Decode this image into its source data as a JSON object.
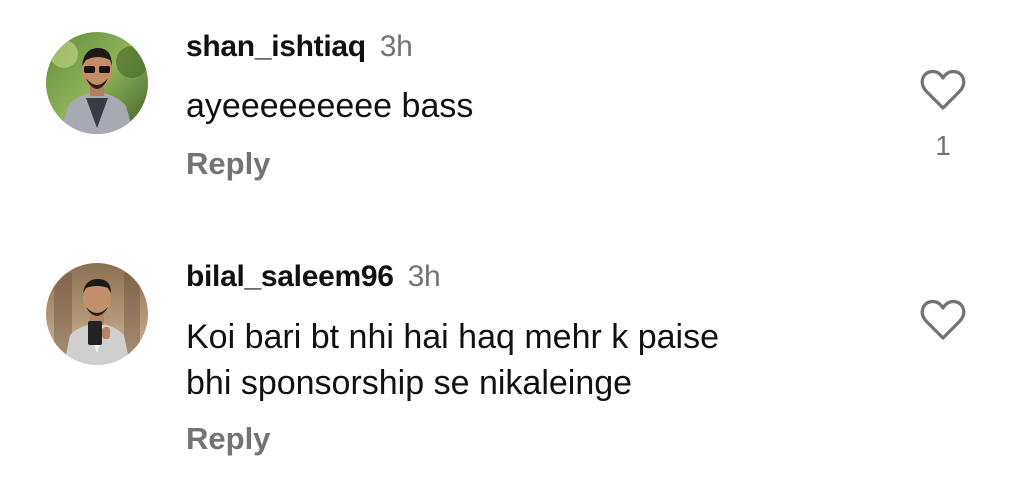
{
  "comments": [
    {
      "username": "shan_ishtiaq",
      "time": "3h",
      "text": "ayeeeeeeeee  bass",
      "reply_label": "Reply",
      "like_count": "1",
      "avatar_icon": "user-photo-avatar-1",
      "heart_icon": "heart-outline-icon"
    },
    {
      "username": "bilal_saleem96",
      "time": "3h",
      "text": "Koi bari bt nhi hai haq mehr k paise\nbhi sponsorship se nikaleinge",
      "reply_label": "Reply",
      "avatar_icon": "user-photo-avatar-2",
      "heart_icon": "heart-outline-icon"
    }
  ],
  "colors": {
    "primary_text": "#111111",
    "secondary_text": "#737373",
    "background": "#ffffff"
  }
}
